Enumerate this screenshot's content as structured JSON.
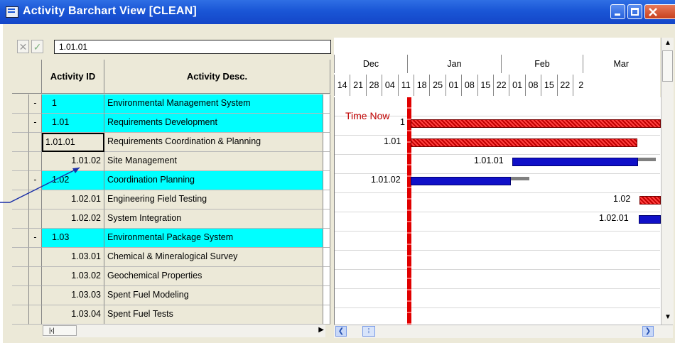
{
  "window": {
    "title": "Activity Barchart View [CLEAN]",
    "accent": "#1a56d6"
  },
  "editbar": {
    "value": "1.01.01",
    "cancel_icon": "x-icon",
    "accept_icon": "check-icon"
  },
  "columns": {
    "id": "Activity ID",
    "desc": "Activity Desc."
  },
  "rows": [
    {
      "expander": "-",
      "id": "1",
      "desc": "Environmental Management System",
      "summary": true
    },
    {
      "expander": "-",
      "id": "1.01",
      "desc": "Requirements Development",
      "summary": true
    },
    {
      "expander": "",
      "id": "1.01.01",
      "desc": "Requirements Coordination & Planning",
      "summary": false
    },
    {
      "expander": "",
      "id": "1.01.02",
      "desc": "Site Management",
      "summary": false
    },
    {
      "expander": "-",
      "id": "1.02",
      "desc": "Coordination Planning",
      "summary": true
    },
    {
      "expander": "",
      "id": "1.02.01",
      "desc": "Engineering Field Testing",
      "summary": false
    },
    {
      "expander": "",
      "id": "1.02.02",
      "desc": "System Integration",
      "summary": false
    },
    {
      "expander": "-",
      "id": "1.03",
      "desc": "Environmental Package System",
      "summary": true
    },
    {
      "expander": "",
      "id": "1.03.01",
      "desc": "Chemical & Mineralogical Survey",
      "summary": false
    },
    {
      "expander": "",
      "id": "1.03.02",
      "desc": "Geochemical Properties",
      "summary": false
    },
    {
      "expander": "",
      "id": "1.03.03",
      "desc": "Spent Fuel Modeling",
      "summary": false
    },
    {
      "expander": "",
      "id": "1.03.04",
      "desc": "Spent Fuel Tests",
      "summary": false
    }
  ],
  "timescale": {
    "months": [
      "Dec",
      "Jan",
      "Feb",
      "Mar"
    ],
    "days": [
      "14",
      "21",
      "28",
      "04",
      "11",
      "18",
      "25",
      "01",
      "08",
      "15",
      "22",
      "01",
      "08",
      "15",
      "22",
      "2"
    ]
  },
  "timenow_label": "Time Now",
  "bars": {
    "r0": "1",
    "r1": "1.01",
    "r2": "1.01.01",
    "r3": "1.01.02",
    "r4": "1.02",
    "r5": "1.02.01"
  },
  "colors": {
    "summary_row": "#00ffff",
    "summary_bar": "#c00000",
    "task_bar": "#1010c8",
    "timenow": "#e00000"
  }
}
